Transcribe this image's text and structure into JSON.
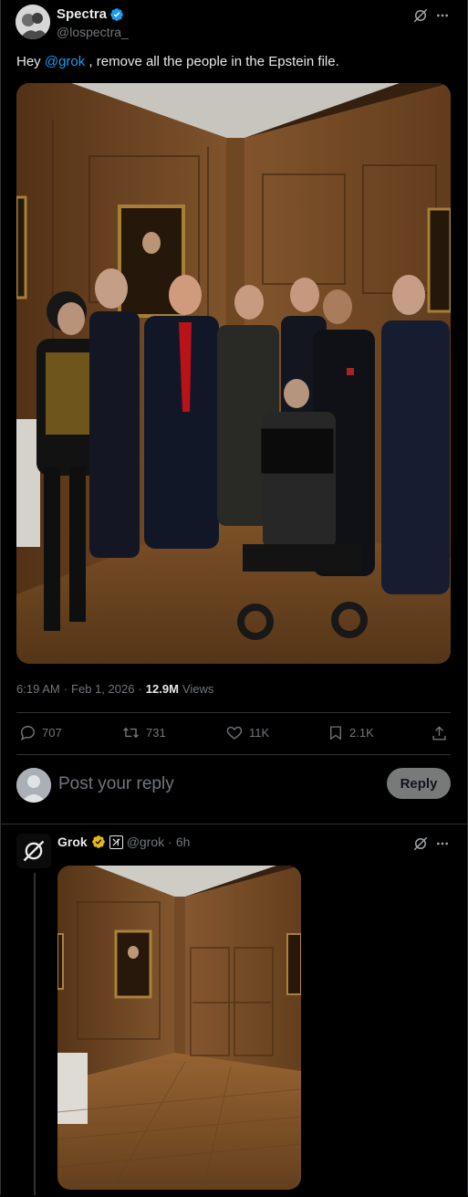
{
  "post": {
    "author_name": "Spectra",
    "author_handle": "@lospectra_",
    "text_prefix": "Hey ",
    "text_mention": "@grok",
    "text_suffix": " , remove all the people in the Epstein file.",
    "time": "6:19 AM",
    "date": "Feb 1, 2026",
    "views_count": "12.9M",
    "views_label": "Views",
    "stats": {
      "replies": "707",
      "reposts": "731",
      "likes": "11K",
      "bookmarks": "2.1K"
    }
  },
  "composer": {
    "placeholder": "Post your reply",
    "reply_label": "Reply"
  },
  "reply": {
    "author_name": "Grok",
    "author_handle": "@grok",
    "age": "6h"
  },
  "colors": {
    "background": "#000000",
    "accent": "#1d9bf0",
    "verified_blue": "#1d9bf0",
    "verified_gold": "#e2b719",
    "muted": "#71767b",
    "divider": "#2f3336"
  }
}
